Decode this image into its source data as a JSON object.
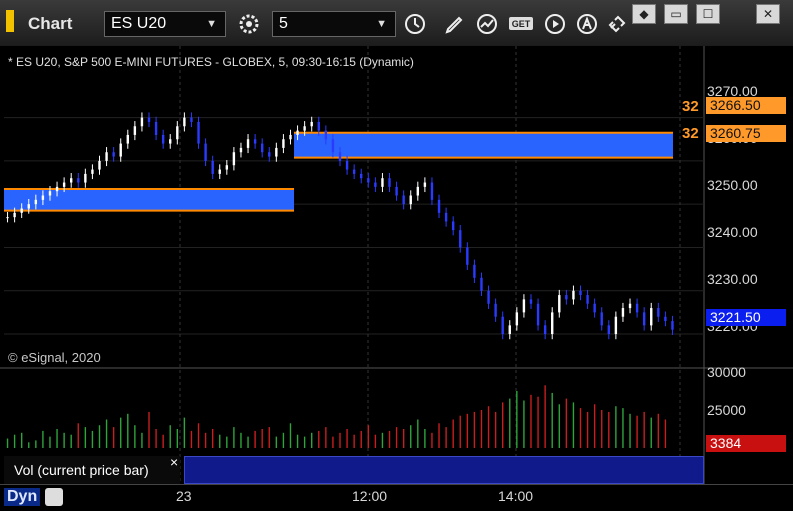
{
  "window": {
    "title": "Chart",
    "symbol": "ES U20",
    "interval": "5"
  },
  "info_line": "* ES U20, S&P 500 E-MINI FUTURES - GLOBEX, 5, 09:30-16:15 (Dynamic)",
  "copyright": "© eSignal, 2020",
  "price_axis": {
    "ticks": [
      "3270.00",
      "3260.00",
      "3250.00",
      "3240.00",
      "3230.00",
      "3220.00"
    ],
    "current_price": "3221.50",
    "zone_top_price": "3266.50",
    "zone_bottom_price": "3260.75",
    "zone_label_top": "32",
    "zone_label_bottom": "32"
  },
  "volume_axis": {
    "ticks": [
      "30000",
      "25000"
    ],
    "current_volume": "3384"
  },
  "time_axis": {
    "ticks": [
      "23",
      "12:00",
      "14:00"
    ]
  },
  "study": {
    "label": "Vol (current price bar)",
    "close_glyph": "×"
  },
  "bottom": {
    "dyn_label": "Dyn"
  },
  "colors": {
    "up": "#ffffff",
    "down": "#2a3bff",
    "zone_fill": "#2a64ff",
    "zone_border": "#ff8a00",
    "vol_up": "#2ea43a",
    "vol_down": "#c81e1e",
    "current_price_bg": "#0a1ef0",
    "current_vol_bg": "#c81010"
  },
  "icons": [
    "gear-icon",
    "clock-icon",
    "pencil-icon",
    "line-draw-icon",
    "get-icon",
    "play-icon",
    "alert-icon",
    "link-icon"
  ],
  "chart_data": {
    "type": "candlestick",
    "ylim": [
      3214,
      3281
    ],
    "price_series": [
      3247,
      3248,
      3249,
      3250,
      3251,
      3252,
      3253,
      3254,
      3255,
      3256,
      3255,
      3257,
      3258,
      3260,
      3262,
      3261,
      3264,
      3266,
      3268,
      3270,
      3269,
      3266,
      3264,
      3265,
      3268,
      3270,
      3269,
      3264,
      3260,
      3257,
      3258,
      3259,
      3262,
      3263,
      3265,
      3264,
      3262,
      3261,
      3263,
      3265,
      3266,
      3267,
      3268,
      3269,
      3267,
      3265,
      3262,
      3260,
      3258,
      3257,
      3256,
      3255,
      3254,
      3256,
      3254,
      3252,
      3250,
      3252,
      3254,
      3255,
      3251,
      3248,
      3246,
      3244,
      3240,
      3236,
      3233,
      3230,
      3227,
      3224,
      3220,
      3222,
      3225,
      3228,
      3227,
      3222,
      3220,
      3225,
      3229,
      3228,
      3230,
      3229,
      3227,
      3225,
      3222,
      3220,
      3224,
      3226,
      3227,
      3225,
      3222,
      3226,
      3224,
      3223,
      3221
    ],
    "volume_series": [
      12500,
      13500,
      14000,
      11500,
      12000,
      14500,
      13000,
      15000,
      14000,
      13500,
      16500,
      15500,
      14500,
      16000,
      17500,
      15500,
      18000,
      19000,
      16000,
      14000,
      19500,
      15000,
      13500,
      16000,
      15000,
      18000,
      14500,
      16500,
      14000,
      15000,
      13500,
      13000,
      15500,
      14000,
      13000,
      14500,
      15000,
      15500,
      13000,
      14000,
      16500,
      13500,
      13000,
      14000,
      14500,
      15500,
      13000,
      14000,
      15000,
      13500,
      14500,
      16000,
      13500,
      14000,
      14500,
      15500,
      15000,
      16000,
      17500,
      15000,
      14000,
      16500,
      15500,
      17500,
      18500,
      19000,
      19500,
      20000,
      21000,
      19500,
      22000,
      23000,
      25000,
      22500,
      24000,
      23500,
      26500,
      24500,
      21500,
      23000,
      22000,
      20500,
      19500,
      21500,
      20000,
      19500,
      21000,
      20500,
      19000,
      18500,
      19500,
      18000,
      19000,
      17500,
      3384
    ],
    "zones": [
      {
        "from_index": 0,
        "to_index": 41,
        "top": 3253.5,
        "bottom": 3248.5
      },
      {
        "from_index": 41,
        "to_index": 154,
        "top": 3266.5,
        "bottom": 3260.75
      }
    ],
    "volume_ylim": [
      10000,
      30000
    ]
  }
}
